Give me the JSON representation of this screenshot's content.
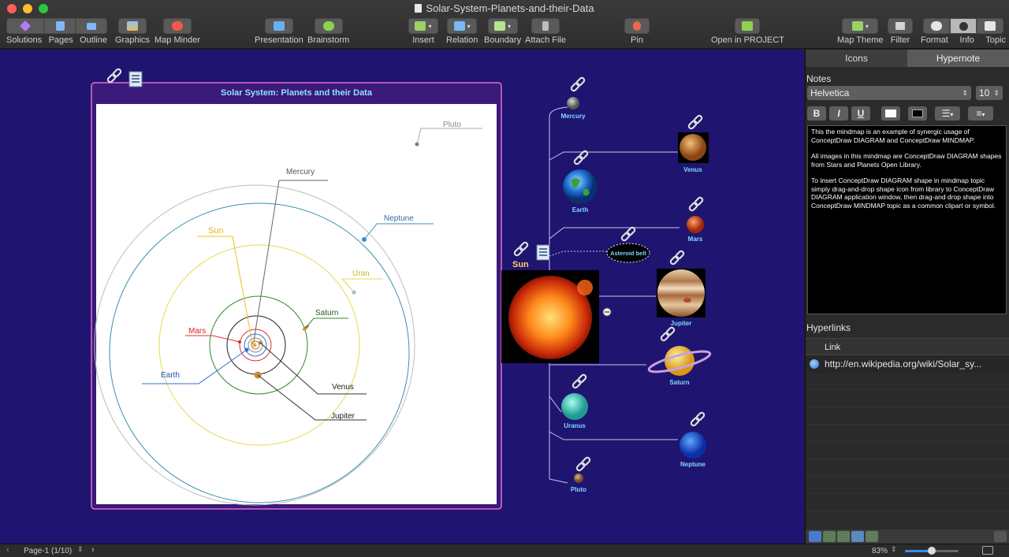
{
  "window": {
    "title": "Solar-System-Planets-and-their-Data"
  },
  "toolbar": {
    "solutions": "Solutions",
    "pages": "Pages",
    "outline": "Outline",
    "graphics": "Graphics",
    "map_minder": "Map Minder",
    "presentation": "Presentation",
    "brainstorm": "Brainstorm",
    "insert": "Insert",
    "relation": "Relation",
    "boundary": "Boundary",
    "attach_file": "Attach File",
    "pin": "Pin",
    "open_in_project": "Open in PROJECT",
    "map_theme": "Map Theme",
    "filter": "Filter",
    "format": "Format",
    "info": "Info",
    "topic": "Topic"
  },
  "diagram": {
    "title": "Solar System: Planets and their Data",
    "labels": {
      "pluto": "Pluto",
      "mercury": "Mercury",
      "neptune": "Neptune",
      "sun": "Sun",
      "uran": "Uran",
      "saturn": "Saturn",
      "mars": "Mars",
      "earth": "Earth",
      "venus": "Venus",
      "jupiter": "Jupiter"
    }
  },
  "mindmap": {
    "central": "Sun",
    "nodes": {
      "mercury": "Mercury",
      "venus": "Venus",
      "earth": "Earth",
      "mars": "Mars",
      "asteroid": "Asteroid belt",
      "jupiter": "Jupiter",
      "saturn": "Saturn",
      "uranus": "Uranus",
      "neptune": "Neptune",
      "pluto": "Pluto"
    }
  },
  "panel": {
    "tab_icons": "Icons",
    "tab_hypernote": "Hypernote",
    "notes_label": "Notes",
    "font_name": "Helvetica",
    "font_size": "10",
    "btn_bold": "B",
    "btn_italic": "I",
    "btn_underline": "U",
    "notes": [
      "This the mindmap is an example of synergic usage of ConceptDraw DIAGRAM and ConceptDraw MINDMAP.",
      "All images in this mindmap are ConceptDraw DIAGRAM shapes from Stars and Planets Open Library.",
      "To insert ConceptDraw DIAGRAM shape in mindmap topic simply drag-and-drop shape icon from library to ConceptDraw DIAGRAM application window, then drag-and drop shape into ConceptDraw MINDMAP topic as a common clipart or symbol."
    ],
    "hyperlinks_label": "Hyperlinks",
    "link_column": "Link",
    "link": "http://en.wikipedia.org/wiki/Solar_sy..."
  },
  "status": {
    "page": "Page-1 (1/10)",
    "zoom": "83%",
    "zoom_level": 0.5
  },
  "colors": {
    "canvas": "#1f1470",
    "node_label": "#7fd8ff",
    "sun_label": "#ffd35a",
    "frame_border": "#e86ad0"
  }
}
